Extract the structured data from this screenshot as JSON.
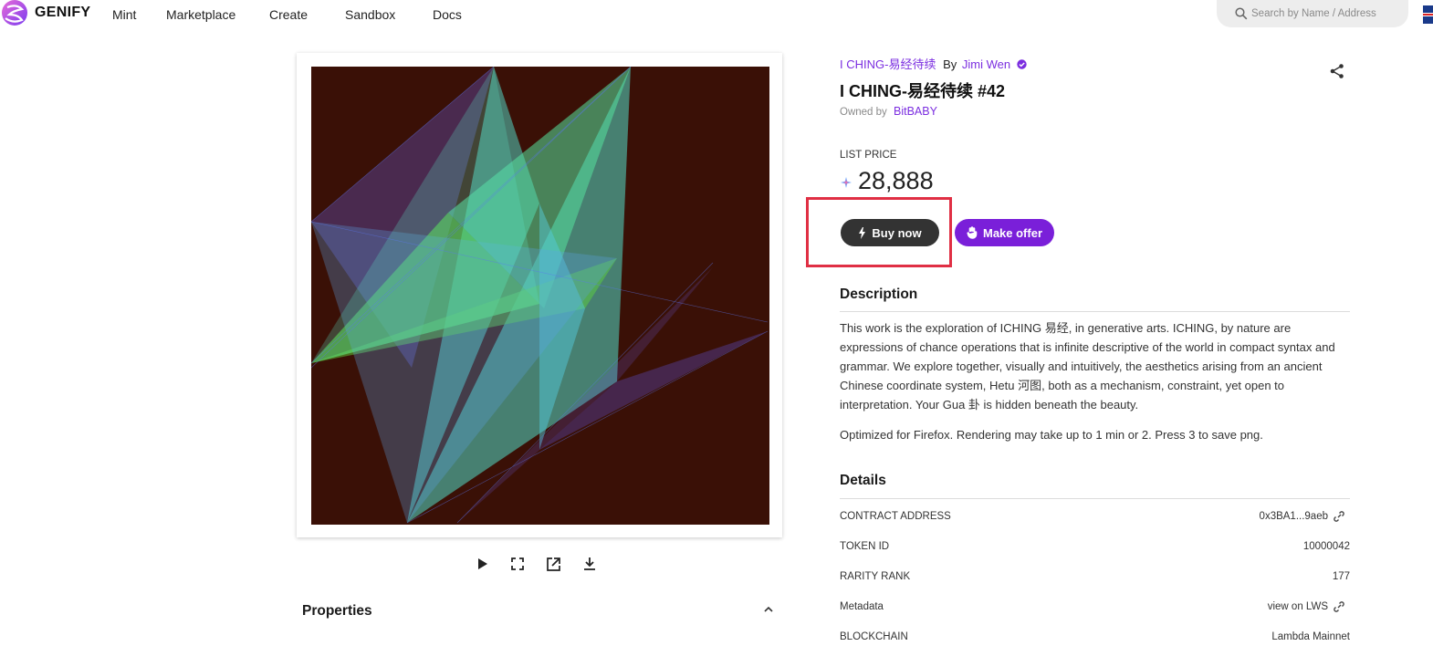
{
  "nav": {
    "brand": "GENIFY",
    "links": [
      "Mint",
      "Marketplace",
      "Create",
      "Sandbox",
      "Docs"
    ],
    "search_placeholder": "Search by Name / Address"
  },
  "artwork": {
    "controls": [
      "play-icon",
      "fullscreen-icon",
      "open-external-icon",
      "download-icon"
    ],
    "colors": {
      "background": "#3a1006",
      "cyan": "#22e0d0",
      "green": "#2ecf3a",
      "blue": "#4466ee"
    }
  },
  "properties": {
    "title": "Properties"
  },
  "item": {
    "collection": "I CHING-易经待续",
    "by_label": "By",
    "creator": "Jimi Wen",
    "title": "I CHING-易经待续 #42",
    "owned_by_label": "Owned by",
    "owner": "BitBABY"
  },
  "price": {
    "label": "LIST PRICE",
    "value": "28,888"
  },
  "actions": {
    "buy_label": "Buy now",
    "offer_label": "Make offer"
  },
  "description": {
    "title": "Description",
    "paragraph1": "This work is the exploration of ICHING 易经, in generative arts. ICHING, by nature are expressions of chance operations that is infinite descriptive of the world in compact syntax and grammar. We explore together, visually and intuitively, the aesthetics arising from an ancient Chinese coordinate system, Hetu 河图, both as a mechanism, constraint, yet open to interpretation. Your Gua 卦 is hidden beneath the beauty.",
    "paragraph2": "Optimized for Firefox. Rendering may take up to 1 min or 2. Press 3 to save png."
  },
  "details": {
    "title": "Details",
    "rows": [
      {
        "label": "CONTRACT ADDRESS",
        "value": "0x3BA1...9aeb"
      },
      {
        "label": "TOKEN ID",
        "value": "10000042"
      },
      {
        "label": "RARITY RANK",
        "value": "177"
      },
      {
        "label": "Metadata",
        "value": "view on LWS"
      },
      {
        "label": "BLOCKCHAIN",
        "value": "Lambda Mainnet"
      }
    ]
  },
  "accent_colors": {
    "purple": "#7b2ee0",
    "highlight": "#e02f44",
    "dark_button": "#333333"
  }
}
